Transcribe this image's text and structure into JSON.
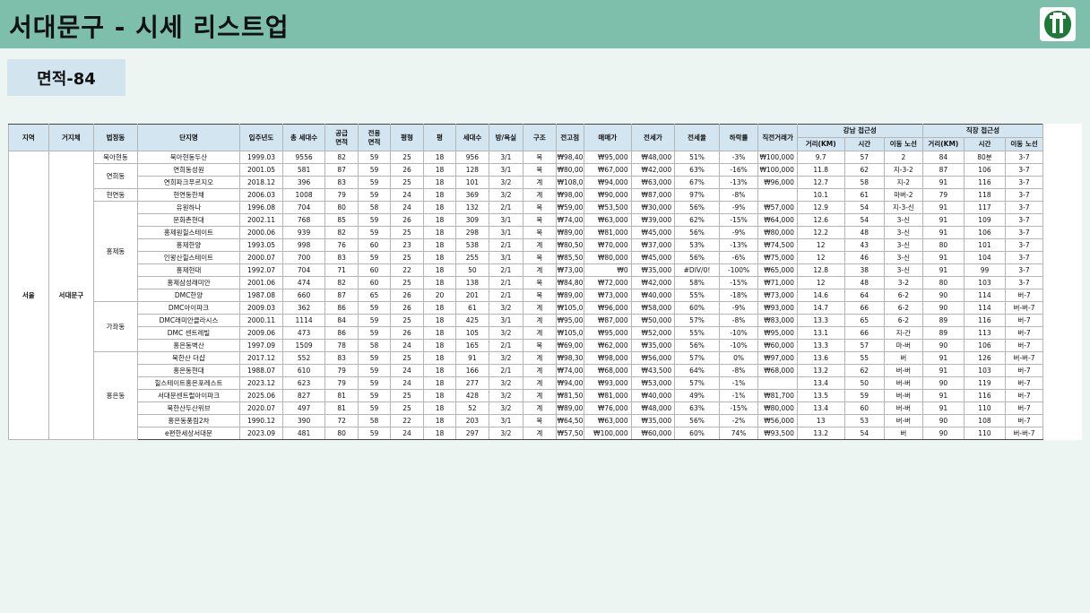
{
  "page": {
    "title": "서대문구 - 시세 리스트업",
    "area_label": "면적-84"
  },
  "table": {
    "headers": {
      "region": "지역",
      "gu": "거지체",
      "dong": "법정동",
      "complex": "단지명",
      "year": "입주년도",
      "households": "총 세대수",
      "supply_area_l1": "공급",
      "supply_area_l2": "면적",
      "exclusive_area_l1": "전용",
      "exclusive_area_l2": "면적",
      "pyeong_type": "평형",
      "pyeong": "평",
      "unit_households": "세대수",
      "rooms": "방/욕실",
      "structure": "구조",
      "peak": "전고점",
      "sale": "매매가",
      "jeonse": "전세가",
      "jeonse_ratio": "전세율",
      "drop": "하락률",
      "recent_deal": "직전거래가",
      "gangnam_group": "강남 접근성",
      "work_group": "직장 접근성",
      "dist": "거리(KM)",
      "time": "시간",
      "route": "이동 노선"
    },
    "region": "서울",
    "gu": "서대문구",
    "dongs": [
      {
        "name": "북아현동",
        "span": 1
      },
      {
        "name": "연희동",
        "span": 2
      },
      {
        "name": "현연동",
        "span": 1
      },
      {
        "name": "홍제동",
        "span": 8
      },
      {
        "name": "가좌동",
        "span": 4
      },
      {
        "name": "홍은동",
        "span": 8
      }
    ],
    "rows": [
      [
        "북아현동두산",
        "1999.03",
        "9556",
        "82",
        "59",
        "25",
        "18",
        "956",
        "3/1",
        "복",
        "₩98,400",
        "₩95,000",
        "₩48,000",
        "51%",
        "-3%",
        "₩100,000",
        "9.7",
        "57",
        "2",
        "84",
        "80분",
        "3-7"
      ],
      [
        "연희동성원",
        "2001.05",
        "581",
        "87",
        "59",
        "26",
        "18",
        "128",
        "3/1",
        "복",
        "₩80,000",
        "₩67,000",
        "₩42,000",
        "63%",
        "-16%",
        "₩100,000",
        "11.8",
        "62",
        "지-3-2",
        "87",
        "106",
        "3-7"
      ],
      [
        "연희파크푸르지오",
        "2018.12",
        "396",
        "83",
        "59",
        "25",
        "18",
        "101",
        "3/2",
        "계",
        "₩108,000",
        "₩94,000",
        "₩63,000",
        "67%",
        "-13%",
        "₩96,000",
        "12.7",
        "58",
        "지-2",
        "91",
        "116",
        "3-7"
      ],
      [
        "현연동한채",
        "2006.03",
        "1008",
        "79",
        "59",
        "24",
        "18",
        "369",
        "3/2",
        "계",
        "₩98,000",
        "₩90,000",
        "₩87,000",
        "97%",
        "-8%",
        "",
        "10.1",
        "61",
        "마버-2",
        "79",
        "118",
        "3-7"
      ],
      [
        "유원하나",
        "1996.08",
        "704",
        "80",
        "58",
        "24",
        "18",
        "132",
        "2/1",
        "복",
        "₩59,000",
        "₩53,500",
        "₩30,000",
        "56%",
        "-9%",
        "₩57,000",
        "12.9",
        "54",
        "지-3-신",
        "91",
        "117",
        "3-7"
      ],
      [
        "문화촌현대",
        "2002.11",
        "768",
        "85",
        "59",
        "26",
        "18",
        "309",
        "3/1",
        "복",
        "₩74,000",
        "₩63,000",
        "₩39,000",
        "62%",
        "-15%",
        "₩64,000",
        "12.6",
        "54",
        "3-신",
        "91",
        "109",
        "3-7"
      ],
      [
        "홍제원힐스테이트",
        "2000.06",
        "939",
        "82",
        "59",
        "25",
        "18",
        "298",
        "3/1",
        "복",
        "₩89,000",
        "₩81,000",
        "₩45,000",
        "56%",
        "-9%",
        "₩80,000",
        "12.2",
        "48",
        "3-신",
        "91",
        "106",
        "3-7"
      ],
      [
        "홍제한양",
        "1993.05",
        "998",
        "76",
        "60",
        "23",
        "18",
        "538",
        "2/1",
        "계",
        "₩80,500",
        "₩70,000",
        "₩37,000",
        "53%",
        "-13%",
        "₩74,500",
        "12",
        "43",
        "3-신",
        "80",
        "101",
        "3-7"
      ],
      [
        "인왕산힐스테이트",
        "2000.07",
        "700",
        "83",
        "59",
        "25",
        "18",
        "255",
        "3/1",
        "복",
        "₩85,500",
        "₩80,000",
        "₩45,000",
        "56%",
        "-6%",
        "₩75,000",
        "12",
        "46",
        "3-신",
        "91",
        "104",
        "3-7"
      ],
      [
        "홍제현대",
        "1992.07",
        "704",
        "71",
        "60",
        "22",
        "18",
        "50",
        "2/1",
        "계",
        "₩73,000",
        "₩0",
        "₩35,000",
        "#DIV/0!",
        "-100%",
        "₩65,000",
        "12.8",
        "38",
        "3-신",
        "91",
        "99",
        "3-7"
      ],
      [
        "홍제삼성래미안",
        "2001.06",
        "474",
        "82",
        "60",
        "25",
        "18",
        "138",
        "2/1",
        "복",
        "₩84,800",
        "₩72,000",
        "₩42,000",
        "58%",
        "-15%",
        "₩71,000",
        "12",
        "48",
        "3-2",
        "80",
        "103",
        "3-7"
      ],
      [
        "DMC한양",
        "1987.08",
        "660",
        "87",
        "65",
        "26",
        "20",
        "201",
        "2/1",
        "복",
        "₩89,000",
        "₩73,000",
        "₩40,000",
        "55%",
        "-18%",
        "₩73,000",
        "14.6",
        "64",
        "6-2",
        "90",
        "114",
        "버-7"
      ],
      [
        "DMC아이파크",
        "2009.03",
        "362",
        "86",
        "59",
        "26",
        "18",
        "61",
        "3/2",
        "계",
        "₩105,000",
        "₩96,000",
        "₩58,000",
        "60%",
        "-9%",
        "₩93,000",
        "14.7",
        "66",
        "6-2",
        "90",
        "114",
        "버-버-7"
      ],
      [
        "DMC래미안클라시스",
        "2000.11",
        "1114",
        "84",
        "59",
        "25",
        "18",
        "425",
        "3/1",
        "계",
        "₩95,000",
        "₩87,000",
        "₩50,000",
        "57%",
        "-8%",
        "₩83,000",
        "13.3",
        "65",
        "6-2",
        "89",
        "116",
        "버-7"
      ],
      [
        "DMC 센트레빌",
        "2009.06",
        "473",
        "86",
        "59",
        "26",
        "18",
        "105",
        "3/2",
        "계",
        "₩105,000",
        "₩95,000",
        "₩52,000",
        "55%",
        "-10%",
        "₩95,000",
        "13.1",
        "66",
        "지-간",
        "89",
        "113",
        "버-7"
      ],
      [
        "홍은동벽산",
        "1997.09",
        "1509",
        "78",
        "58",
        "24",
        "18",
        "165",
        "2/1",
        "복",
        "₩69,000",
        "₩62,000",
        "₩35,000",
        "56%",
        "-10%",
        "₩60,000",
        "13.3",
        "57",
        "마-버",
        "90",
        "106",
        "버-7"
      ],
      [
        "북한산 더샵",
        "2017.12",
        "552",
        "83",
        "59",
        "25",
        "18",
        "91",
        "3/2",
        "계",
        "₩98,300",
        "₩98,000",
        "₩56,000",
        "57%",
        "0%",
        "₩97,000",
        "13.6",
        "55",
        "버",
        "91",
        "126",
        "버-버-7"
      ],
      [
        "홍은동현대",
        "1988.07",
        "610",
        "79",
        "59",
        "24",
        "18",
        "166",
        "2/1",
        "계",
        "₩74,000",
        "₩68,000",
        "₩43,500",
        "64%",
        "-8%",
        "₩68,000",
        "13.2",
        "62",
        "버-버",
        "91",
        "103",
        "버-7"
      ],
      [
        "힐스테이트홍은포레스트",
        "2023.12",
        "623",
        "79",
        "59",
        "24",
        "18",
        "277",
        "3/2",
        "계",
        "₩94,000",
        "₩93,000",
        "₩53,000",
        "57%",
        "-1%",
        "",
        "13.4",
        "50",
        "버-버",
        "90",
        "119",
        "버-7"
      ],
      [
        "서대문센트럴아이파크",
        "2025.06",
        "827",
        "81",
        "59",
        "25",
        "18",
        "428",
        "3/2",
        "계",
        "₩81,500",
        "₩81,000",
        "₩40,000",
        "49%",
        "-1%",
        "₩81,700",
        "13.5",
        "59",
        "버-버",
        "91",
        "116",
        "버-7"
      ],
      [
        "북한산두산위브",
        "2020.07",
        "497",
        "81",
        "59",
        "25",
        "18",
        "52",
        "3/2",
        "계",
        "₩89,000",
        "₩76,000",
        "₩48,000",
        "63%",
        "-15%",
        "₩80,000",
        "13.4",
        "60",
        "버-버",
        "91",
        "110",
        "버-7"
      ],
      [
        "홍은동풍림2차",
        "1990.12",
        "390",
        "72",
        "58",
        "22",
        "18",
        "203",
        "3/1",
        "복",
        "₩64,500",
        "₩63,000",
        "₩35,000",
        "56%",
        "-2%",
        "₩56,000",
        "13",
        "53",
        "버-버",
        "90",
        "108",
        "버-7"
      ],
      [
        "e편한세상서대문",
        "2023.09",
        "481",
        "80",
        "59",
        "24",
        "18",
        "297",
        "3/2",
        "계",
        "₩57,500",
        "₩100,000",
        "₩60,000",
        "60%",
        "74%",
        "₩93,500",
        "13.2",
        "54",
        "버",
        "90",
        "110",
        "버-버-7"
      ]
    ]
  }
}
